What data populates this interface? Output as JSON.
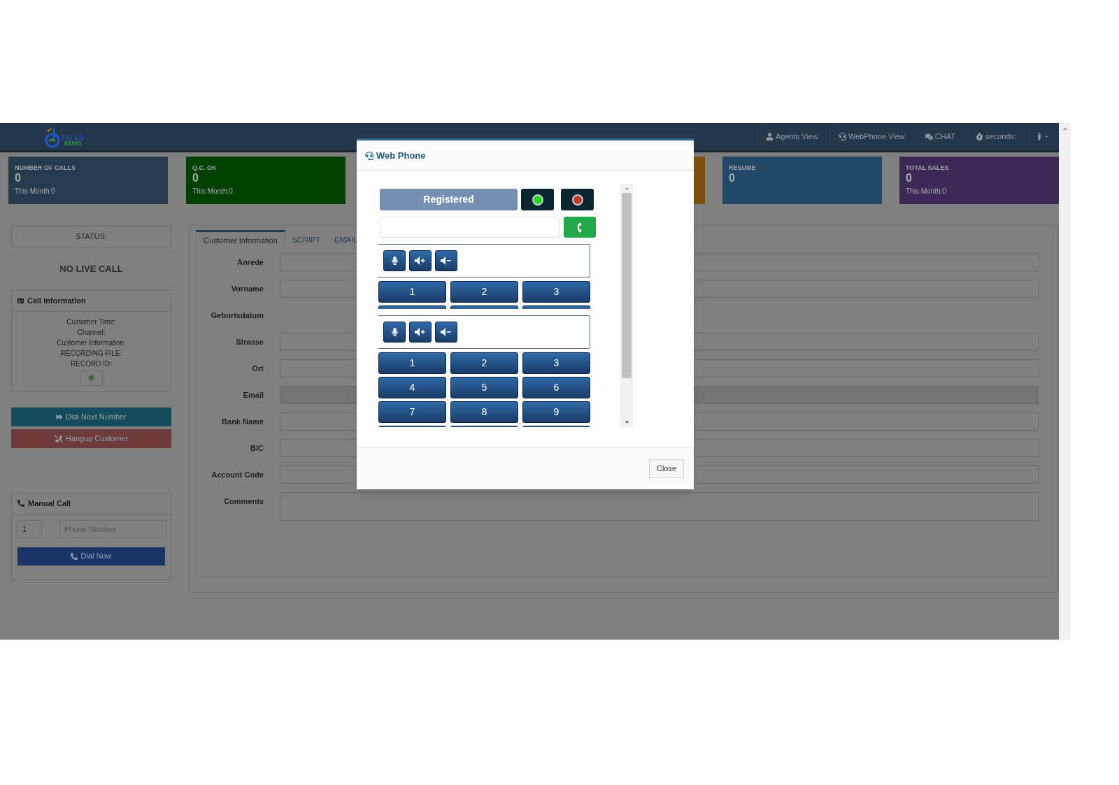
{
  "logo": {
    "line_1": "IALER",
    "line_2": "KONG"
  },
  "nav": [
    {
      "kind": "user",
      "label": "Agents View"
    },
    {
      "kind": "headset",
      "label": "WebPhone View"
    },
    {
      "kind": "chat",
      "label": "CHAT"
    },
    {
      "kind": "stopwatch",
      "label": "seconds:"
    },
    {
      "kind": "user-menu"
    }
  ],
  "cards_left": [
    {
      "title": "NUMBER OF CALLS",
      "value": "0",
      "month": "This Month:0",
      "color": "#263a4e"
    },
    {
      "title": "Q.C. OK",
      "value": "0",
      "month": "This Month:0",
      "color": "#024002"
    }
  ],
  "cards_right": [
    {
      "color": "#7a5210"
    },
    {
      "title": "RESUME",
      "value": "0",
      "color": "#224767"
    },
    {
      "title": "TOTAL SALES",
      "value": "0",
      "month": "This Month:0",
      "color": "#3b2a55"
    }
  ],
  "status": {
    "label": "STATUS:",
    "live": "NO LIVE CALL"
  },
  "call_information": {
    "title": "Call Information",
    "lines": [
      "Customer Time:",
      "Channel:",
      "Customer Information:",
      "RECORDING FILE:",
      "RECORD ID:"
    ]
  },
  "actions": [
    {
      "kind": "next",
      "label": "Dial Next Number"
    },
    {
      "kind": "hangup",
      "label": "Hangup Customer"
    }
  ],
  "manual_call": {
    "title": "Manual Call",
    "code": "1",
    "placeholder": "Phone Number",
    "button": "Dial Now"
  },
  "tabs": [
    {
      "label": "Customer Information",
      "selected": true
    },
    {
      "label": "SCRIPT",
      "selected": false
    },
    {
      "label": "EMAIL",
      "selected": false
    }
  ],
  "fields": [
    {
      "label": "Anrede",
      "kind": "input",
      "disabled": false
    },
    {
      "label": "Vorname",
      "kind": "input",
      "disabled": false
    },
    {
      "label": "Geburtsdatum",
      "kind": "none"
    },
    {
      "label": "Strasse",
      "kind": "input",
      "disabled": false
    },
    {
      "label": "Ort",
      "kind": "input",
      "disabled": false
    },
    {
      "label": "Email",
      "kind": "input",
      "disabled": true
    },
    {
      "label": "Bank Name",
      "kind": "input",
      "disabled": false
    },
    {
      "label": "BIC",
      "kind": "input",
      "disabled": false
    },
    {
      "label": "Account Code",
      "kind": "input",
      "disabled": false
    },
    {
      "label": "Comments",
      "kind": "textarea"
    }
  ],
  "web_phone": {
    "title": "Web Phone",
    "registration": "Registered",
    "indicators": [
      {
        "color": "#22dd22"
      },
      {
        "color": "#c0392b"
      }
    ],
    "phones": [
      {
        "keys": [
          "1",
          "2",
          "3"
        ]
      },
      {
        "keys": [
          "1",
          "2",
          "3",
          "4",
          "5",
          "6",
          "7",
          "8",
          "9"
        ]
      }
    ],
    "close": "Close"
  }
}
